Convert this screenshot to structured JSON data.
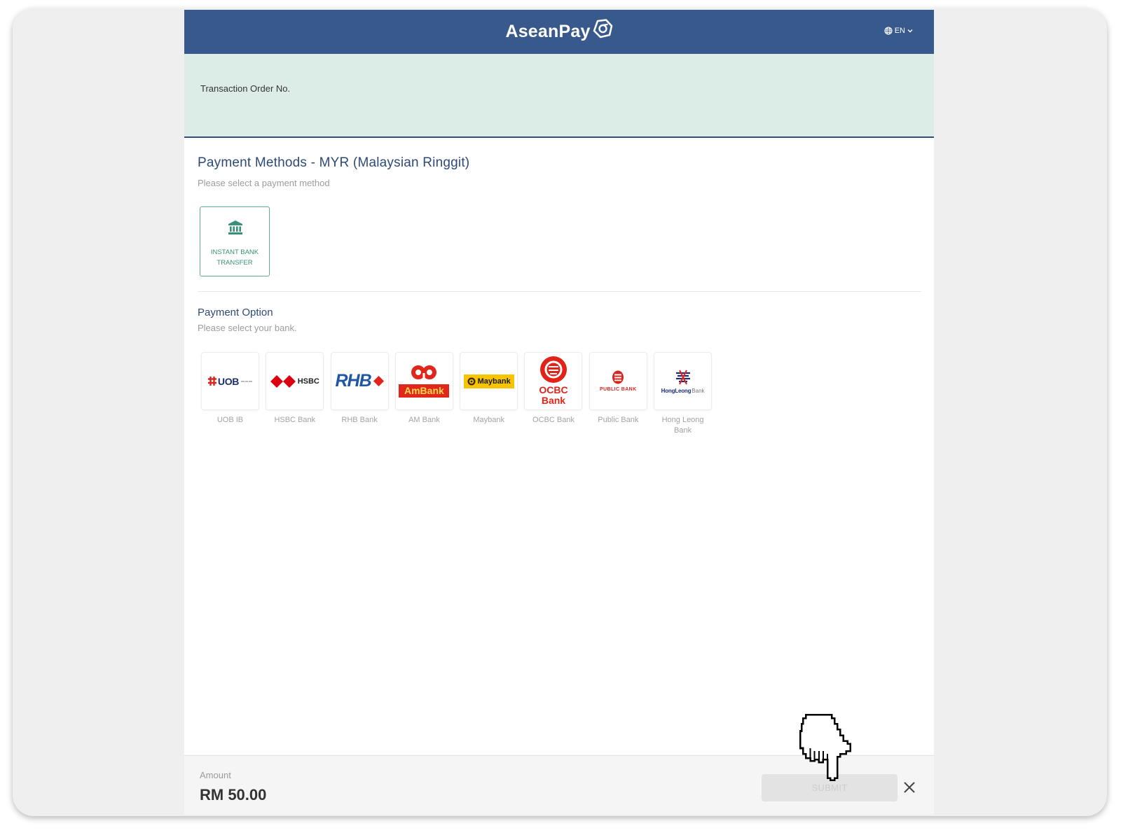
{
  "header": {
    "brand": "AseanPay",
    "brand_icon": "aseanpay-logo-icon",
    "language": "EN",
    "language_icon": "globe-icon"
  },
  "transaction": {
    "order_label": "Transaction Order No."
  },
  "payment_methods": {
    "title": "Payment Methods - MYR (Malaysian Ringgit)",
    "subtitle": "Please select a payment method",
    "methods": [
      {
        "label": "INSTANT BANK TRANSFER",
        "icon": "bank-building-icon",
        "selected": true
      }
    ]
  },
  "payment_option": {
    "title": "Payment Option",
    "subtitle": "Please select your bank.",
    "banks": [
      {
        "label": "UOB IB",
        "logo_text": "UOB"
      },
      {
        "label": "HSBC Bank",
        "logo_text": "HSBC"
      },
      {
        "label": "RHB Bank",
        "logo_text": "RHB"
      },
      {
        "label": "AM Bank",
        "logo_text": "AmBank"
      },
      {
        "label": "Maybank",
        "logo_text": "Maybank"
      },
      {
        "label": "OCBC Bank",
        "logo_text": "OCBC",
        "logo_subtext": "Bank"
      },
      {
        "label": "Public Bank",
        "logo_text": "PUBLIC BANK"
      },
      {
        "label": "Hong Leong Bank",
        "logo_text": "HongLeong",
        "logo_subtext": "Bank"
      }
    ]
  },
  "footer": {
    "amount_label": "Amount",
    "amount": "RM 50.00",
    "submit_label": "SUBMIT",
    "submit_enabled": false,
    "close_icon": "close-icon"
  },
  "overlay": {
    "cursor_icon": "hand-pointer-icon"
  },
  "colors": {
    "header": "#37598c",
    "accent_green": "#3a8f78",
    "title_blue": "#2d4a77",
    "info_band": "#dcede7"
  }
}
